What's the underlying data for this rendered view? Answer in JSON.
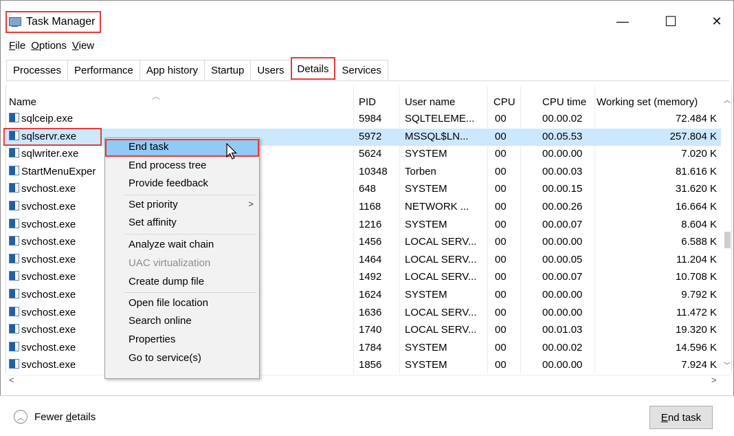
{
  "window": {
    "title": "Task Manager",
    "minimize": "—",
    "maximize": "☐",
    "close": "✕"
  },
  "menu": {
    "file": "F",
    "file_rest": "ile",
    "options": "O",
    "options_rest": "ptions",
    "view": "V",
    "view_rest": "iew"
  },
  "tabs": [
    "Processes",
    "Performance",
    "App history",
    "Startup",
    "Users",
    "Details",
    "Services"
  ],
  "table": {
    "columns": {
      "name": "Name",
      "pid": "PID",
      "user": "User name",
      "cpu": "CPU",
      "cpu_time": "CPU time",
      "working_set": "Working set (memory)"
    },
    "rows": [
      {
        "name": "sqlceip.exe",
        "pid": "5984",
        "user": "SQLTELEME...",
        "cpu": "00",
        "cpu_time": "00.00.02",
        "ws": "72.484 K"
      },
      {
        "name": "sqlservr.exe",
        "pid": "5972",
        "user": "MSSQL$LN...",
        "cpu": "00",
        "cpu_time": "00.05.53",
        "ws": "257.804 K"
      },
      {
        "name": "sqlwriter.exe",
        "pid": "5624",
        "user": "SYSTEM",
        "cpu": "00",
        "cpu_time": "00.00.00",
        "ws": "7.020 K"
      },
      {
        "name": "StartMenuExper",
        "pid": "10348",
        "user": "Torben",
        "cpu": "00",
        "cpu_time": "00.00.03",
        "ws": "81.616 K"
      },
      {
        "name": "svchost.exe",
        "pid": "648",
        "user": "SYSTEM",
        "cpu": "00",
        "cpu_time": "00.00.15",
        "ws": "31.620 K"
      },
      {
        "name": "svchost.exe",
        "pid": "1168",
        "user": "NETWORK ...",
        "cpu": "00",
        "cpu_time": "00.00.26",
        "ws": "16.664 K"
      },
      {
        "name": "svchost.exe",
        "pid": "1216",
        "user": "SYSTEM",
        "cpu": "00",
        "cpu_time": "00.00.07",
        "ws": "8.604 K"
      },
      {
        "name": "svchost.exe",
        "pid": "1456",
        "user": "LOCAL SERV...",
        "cpu": "00",
        "cpu_time": "00.00.00",
        "ws": "6.588 K"
      },
      {
        "name": "svchost.exe",
        "pid": "1464",
        "user": "LOCAL SERV...",
        "cpu": "00",
        "cpu_time": "00.00.05",
        "ws": "11.204 K"
      },
      {
        "name": "svchost.exe",
        "pid": "1492",
        "user": "LOCAL SERV...",
        "cpu": "00",
        "cpu_time": "00.00.07",
        "ws": "10.708 K"
      },
      {
        "name": "svchost.exe",
        "pid": "1624",
        "user": "SYSTEM",
        "cpu": "00",
        "cpu_time": "00.00.00",
        "ws": "9.792 K"
      },
      {
        "name": "svchost.exe",
        "pid": "1636",
        "user": "LOCAL SERV...",
        "cpu": "00",
        "cpu_time": "00.00.00",
        "ws": "11.472 K"
      },
      {
        "name": "svchost.exe",
        "pid": "1740",
        "user": "LOCAL SERV...",
        "cpu": "00",
        "cpu_time": "00.01.03",
        "ws": "19.320 K"
      },
      {
        "name": "svchost.exe",
        "pid": "1784",
        "user": "SYSTEM",
        "cpu": "00",
        "cpu_time": "00.00.02",
        "ws": "14.596 K"
      },
      {
        "name": "svchost.exe",
        "pid": "1856",
        "user": "SYSTEM",
        "cpu": "00",
        "cpu_time": "00.00.00",
        "ws": "7.924 K"
      }
    ]
  },
  "context_menu": {
    "end_task": "End task",
    "end_process_tree": "End process tree",
    "provide_feedback": "Provide feedback",
    "set_priority": "Set priority",
    "set_affinity": "Set affinity",
    "analyze_wait_chain": "Analyze wait chain",
    "uac_virtualization": "UAC virtualization",
    "create_dump_file": "Create dump file",
    "open_file_location": "Open file location",
    "search_online": "Search online",
    "properties": "Properties",
    "go_to_services": "Go to service(s)"
  },
  "footer": {
    "fewer_details_pre": "Fewer ",
    "fewer_details_u": "d",
    "fewer_details_post": "etails",
    "end_task_u": "E",
    "end_task_rest": "nd task"
  },
  "colors": {
    "selection": "#cce8ff",
    "menu_hover": "#91c9f7",
    "highlight_box": "#e53b3b"
  }
}
